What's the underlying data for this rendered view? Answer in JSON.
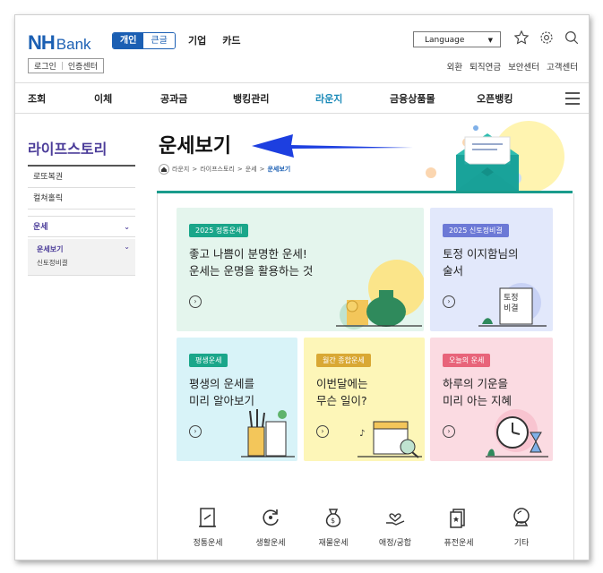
{
  "header": {
    "logo_nh": "NH",
    "logo_bank": "Bank",
    "segment_on": "개인",
    "segment_off": "큰글",
    "topnav": [
      "기업",
      "카드"
    ],
    "login": "로그인",
    "cert": "인증센터",
    "language": "Language",
    "util": [
      "외환",
      "퇴직연금",
      "보안센터",
      "고객센터"
    ]
  },
  "mainnav": [
    "조회",
    "이체",
    "공과금",
    "뱅킹관리",
    "라운지",
    "금융상품몰",
    "오픈뱅킹"
  ],
  "sidebar": {
    "title": "라이프스토리",
    "items": [
      "로또복권",
      "컬쳐홀릭",
      "운세"
    ],
    "sub_active": "운세보기",
    "sub_other": "신토정비결"
  },
  "content": {
    "page_title": "운세보기",
    "breadcrumb": [
      "라운지",
      "라이프스토리",
      "운세",
      "운세보기"
    ],
    "cards": [
      {
        "badge": "2025 정통운세",
        "line1": "좋고 나쁨이 분명한 운세!",
        "line2": "운세는 운명을 활용하는 것"
      },
      {
        "badge": "2025 신토정비결",
        "line1": "토정 이지함님의",
        "line2": "술서"
      },
      {
        "badge": "평생운세",
        "line1": "평생의 운세를",
        "line2": "미리 알아보기"
      },
      {
        "badge": "월간 종합운세",
        "line1": "이번달에는",
        "line2": "무슨 일이?"
      },
      {
        "badge": "오늘의 운세",
        "line1": "하루의 기운을",
        "line2": "미리 아는 지혜"
      }
    ],
    "book_label_1": "토정",
    "book_label_2": "비결",
    "categories": [
      "정통운세",
      "생활운세",
      "재물운세",
      "애정/궁합",
      "퓨전운세",
      "기타"
    ]
  },
  "colors": {
    "brand": "#1b5fb3",
    "sidebar_accent": "#4b3c99",
    "teal": "#1a9b8c",
    "nav_active": "#1b8ab8"
  }
}
